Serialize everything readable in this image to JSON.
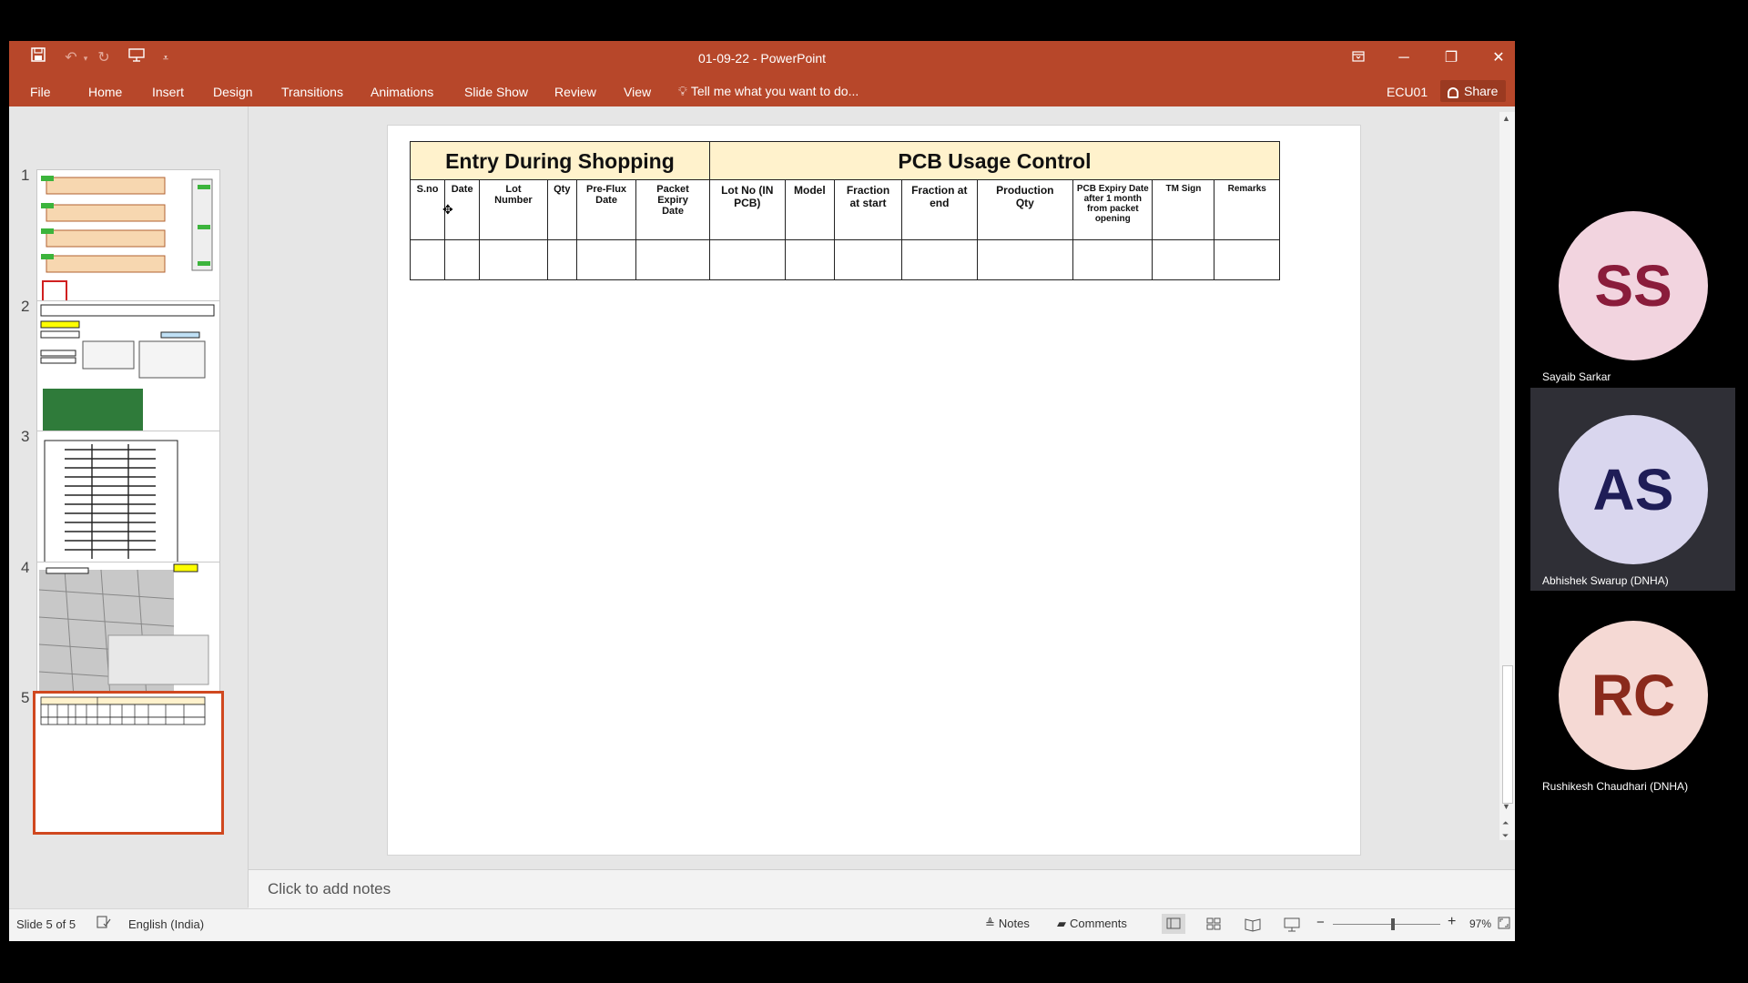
{
  "window": {
    "title": "01-09-22 - PowerPoint"
  },
  "ribbon": {
    "tabs": [
      "File",
      "Home",
      "Insert",
      "Design",
      "Transitions",
      "Animations",
      "Slide Show",
      "Review",
      "View"
    ],
    "tell_me": "Tell me what you want to do...",
    "account": "ECU01",
    "share": "Share"
  },
  "thumbnails": {
    "numbers": [
      "1",
      "2",
      "3",
      "4",
      "5"
    ],
    "selected": "5"
  },
  "slide": {
    "header": {
      "left": "Entry During Shopping",
      "right": "PCB Usage Control"
    },
    "columns": [
      "S.no",
      "Date",
      "Lot Number",
      "Qty",
      "Pre-Flux Date",
      "Packet Expiry Date",
      "Lot No (IN PCB)",
      "Model",
      "Fraction at start",
      "Fraction at end",
      "Production Qty",
      "PCB Expiry Date after 1 month from packet opening",
      "TM Sign",
      "Remarks"
    ],
    "header_fill": "#fff2cc"
  },
  "notes": {
    "placeholder": "Click to add notes"
  },
  "status": {
    "slide_info": "Slide 5 of 5",
    "language": "English (India)",
    "notes_btn": "Notes",
    "comments_btn": "Comments",
    "zoom": "97%",
    "zoom_level": 0.56
  },
  "participants": [
    {
      "initials": "SS",
      "name": "Sayaib  Sarkar",
      "bg": "#f2d4df",
      "fg": "#8a1c3b"
    },
    {
      "initials": "AS",
      "name": "Abhishek Swarup (DNHA)",
      "bg": "#d9d6ee",
      "fg": "#1f1d57"
    },
    {
      "initials": "RC",
      "name": "Rushikesh Chaudhari (DNHA)",
      "bg": "#f5d9d4",
      "fg": "#8a2a1c"
    }
  ],
  "colors": {
    "accent": "#b7472a",
    "selected_thumb": "#d0481f"
  }
}
